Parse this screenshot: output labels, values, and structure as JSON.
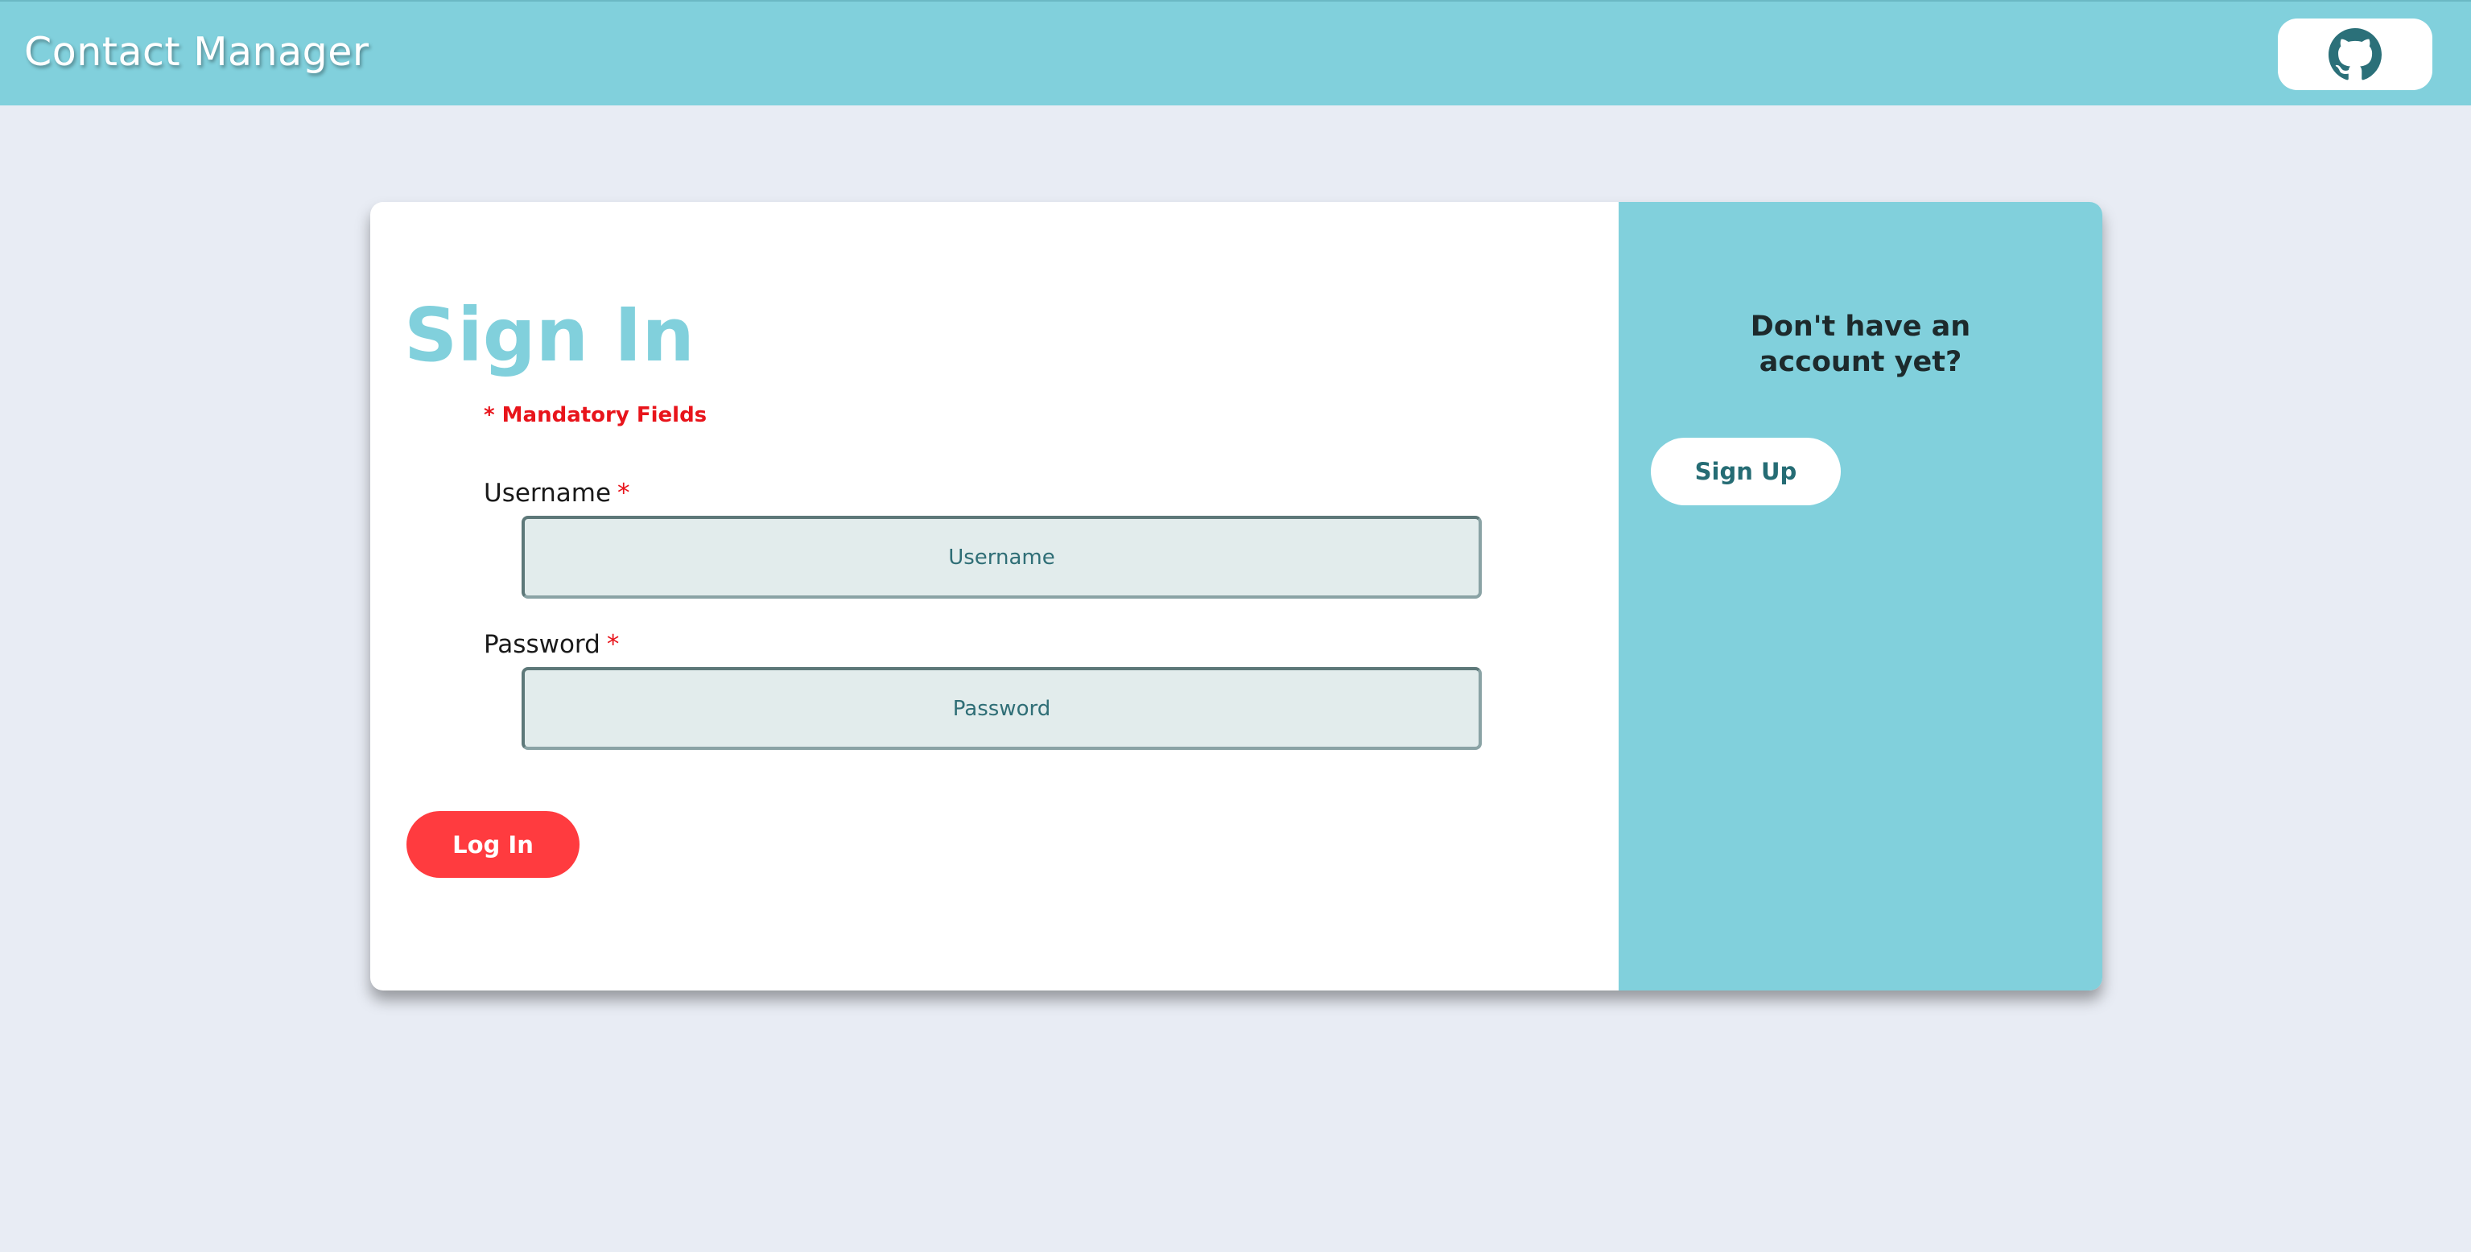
{
  "navbar": {
    "brand": "Contact Manager",
    "github_icon": "github-icon",
    "color": "#81d0dc"
  },
  "signin": {
    "title": "Sign In",
    "mandatory_note": "* Mandatory Fields",
    "username": {
      "label": "Username",
      "required_mark": "*",
      "placeholder": "Username",
      "value": ""
    },
    "password": {
      "label": "Password",
      "required_mark": "*",
      "placeholder": "Password",
      "value": ""
    },
    "login_label": "Log In",
    "login_color": "#ff3b3f"
  },
  "signup_panel": {
    "prompt": "Don't have an account yet?",
    "signup_label": "Sign Up"
  }
}
